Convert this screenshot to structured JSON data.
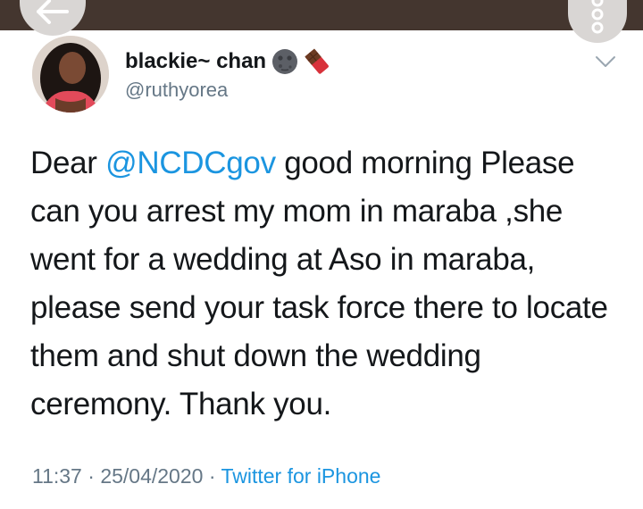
{
  "header": {
    "back_icon": "arrow-left-icon",
    "more_icon": "more-options-icon"
  },
  "author": {
    "display_name": "blackie~ chan",
    "emojis": [
      "new-moon-face-emoji",
      "chocolate-bar-emoji"
    ],
    "handle": "@ruthyorea"
  },
  "tweet": {
    "greeting": "Dear",
    "mention": "@NCDCgov",
    "text": " good morning Please can you arrest my mom in maraba ,she went for a wedding at Aso in maraba, please send your task force there to locate them and shut down the wedding ceremony. Thank you."
  },
  "meta": {
    "time": "11:37",
    "separator": " · ",
    "date": "25/04/2020",
    "source": "Twitter for iPhone"
  },
  "colors": {
    "link": "#1b95e0",
    "secondary": "#657786",
    "text": "#14171a",
    "topbar": "#44362f"
  }
}
